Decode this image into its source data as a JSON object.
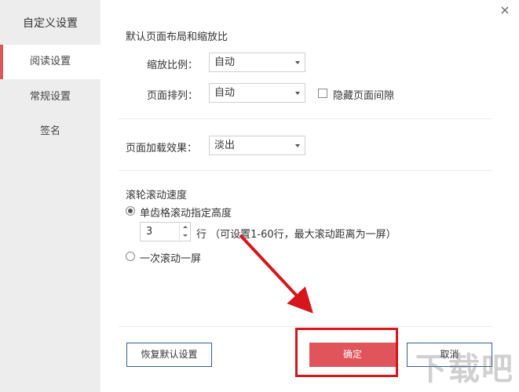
{
  "sidebar": {
    "title": "自定义设置",
    "items": [
      {
        "label": "阅读设置",
        "active": true
      },
      {
        "label": "常规设置",
        "active": false
      },
      {
        "label": "签名",
        "active": false
      }
    ]
  },
  "sections": {
    "layout": {
      "heading": "默认页面布局和缩放比",
      "zoom_label": "缩放比例：",
      "zoom_value": "自动",
      "arrange_label": "页面排列：",
      "arrange_value": "自动",
      "hide_gap_label": "隐藏页面间隙",
      "hide_gap_checked": false
    },
    "load": {
      "label": "页面加载效果：",
      "value": "淡出"
    },
    "scroll": {
      "heading": "滚轮滚动速度",
      "option1_label": "单齿格滚动指定高度",
      "option1_checked": true,
      "rows_value": "3",
      "rows_hint": "行 （可设置1-60行，最大滚动距离为一屏）",
      "option2_label": "一次滚动一屏",
      "option2_checked": false
    }
  },
  "buttons": {
    "restore_label": "恢复默认设置",
    "ok_label": "确定",
    "cancel_label": "取消"
  },
  "watermark": "下载吧",
  "colors": {
    "accent": "#e0545b",
    "annotation": "#d6161c",
    "sidebar_bg": "#ededed"
  },
  "icons": {
    "close": "close-icon",
    "dropdown": "chevron-down-icon"
  }
}
